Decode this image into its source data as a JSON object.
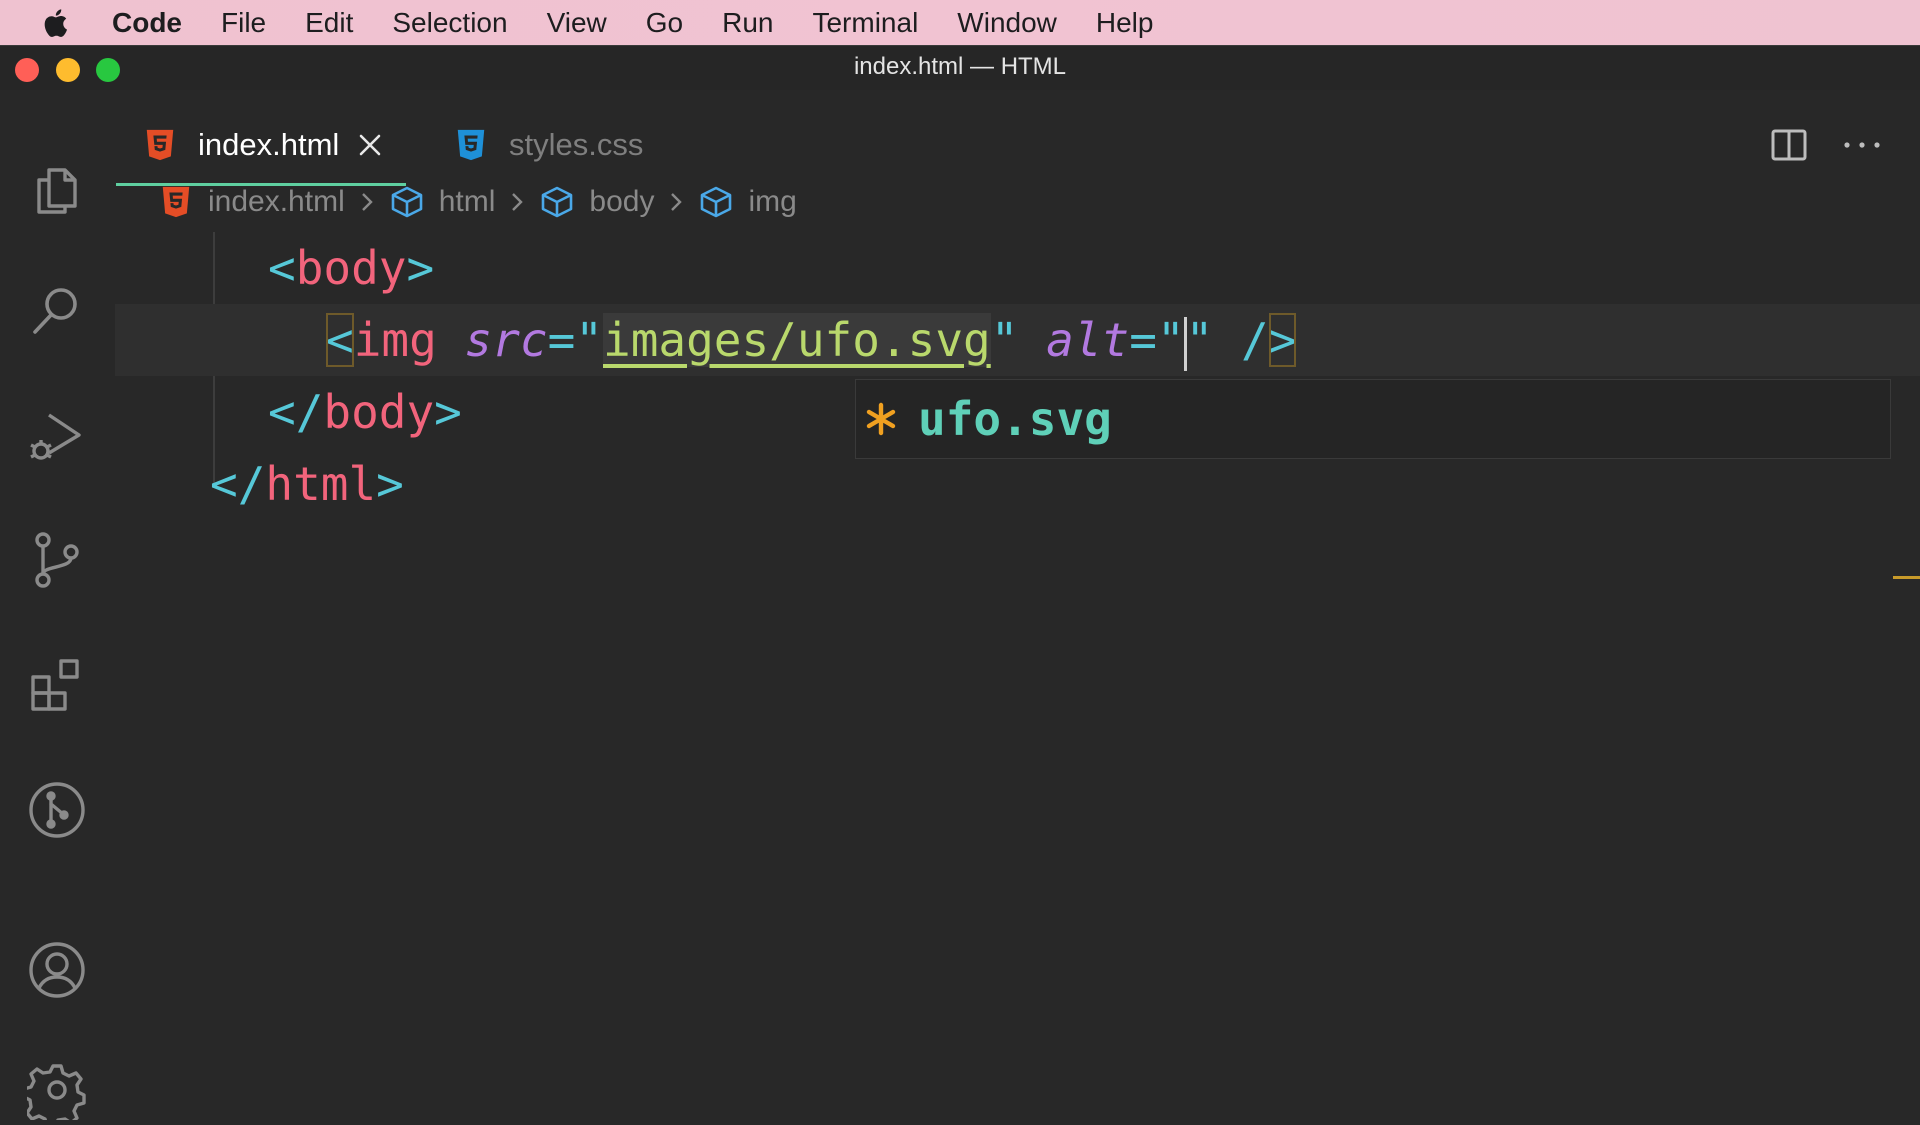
{
  "menubar": {
    "app_name": "Code",
    "items": [
      "File",
      "Edit",
      "Selection",
      "View",
      "Go",
      "Run",
      "Terminal",
      "Window",
      "Help"
    ]
  },
  "window": {
    "title": "index.html — HTML"
  },
  "activity_bar": {
    "icons": [
      "explorer-icon",
      "search-icon",
      "run-debug-icon",
      "source-control-icon",
      "extensions-icon",
      "git-graph-icon",
      "accounts-icon",
      "settings-gear-icon"
    ]
  },
  "tabs": [
    {
      "label": "index.html",
      "icon": "html5-icon",
      "active": true
    },
    {
      "label": "styles.css",
      "icon": "css3-icon",
      "active": false
    }
  ],
  "breadcrumb": [
    "index.html",
    "html",
    "body",
    "img"
  ],
  "code": {
    "line1": {
      "open": "<",
      "tag": "body",
      "close": ">"
    },
    "line2": {
      "open": "<",
      "tag": "img",
      "attr1": "src",
      "eq1": "=",
      "q1": "\"",
      "val1": "images/ufo.svg",
      "q2": "\"",
      "attr2": "alt",
      "eq2": "=",
      "q3": "\"",
      "q4": "\"",
      "selfclose": "/",
      "close": ">"
    },
    "line3": {
      "open": "</",
      "tag": "body",
      "close": ">"
    },
    "line4": {
      "open": "</",
      "tag": "html",
      "close": ">"
    }
  },
  "suggestion": {
    "label": "ufo.svg",
    "icon": "file-asterisk-icon"
  },
  "colors": {
    "accent": "#5fcfa0",
    "html_icon": "#e44d26",
    "css_icon": "#1e90d8",
    "tag": "#f2647c",
    "punct": "#56c8d8",
    "attr": "#b279e0",
    "string": "#b9d86c"
  }
}
